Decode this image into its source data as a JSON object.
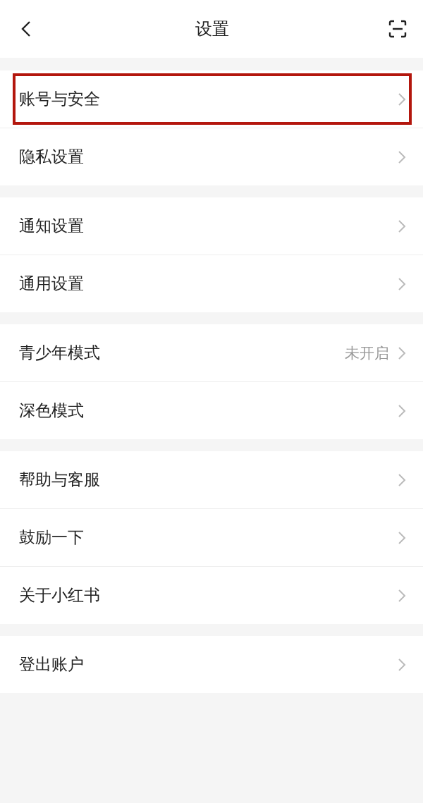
{
  "header": {
    "title": "设置"
  },
  "groups": [
    {
      "items": [
        {
          "label": "账号与安全",
          "highlighted": true
        },
        {
          "label": "隐私设置",
          "highlighted": false
        }
      ]
    },
    {
      "items": [
        {
          "label": "通知设置",
          "highlighted": false
        },
        {
          "label": "通用设置",
          "highlighted": false
        }
      ]
    },
    {
      "items": [
        {
          "label": "青少年模式",
          "value": "未开启",
          "highlighted": false
        },
        {
          "label": "深色模式",
          "highlighted": false
        }
      ]
    },
    {
      "items": [
        {
          "label": "帮助与客服",
          "highlighted": false
        },
        {
          "label": "鼓励一下",
          "highlighted": false
        },
        {
          "label": "关于小红书",
          "highlighted": false
        }
      ]
    },
    {
      "items": [
        {
          "label": "登出账户",
          "highlighted": false
        }
      ]
    }
  ]
}
